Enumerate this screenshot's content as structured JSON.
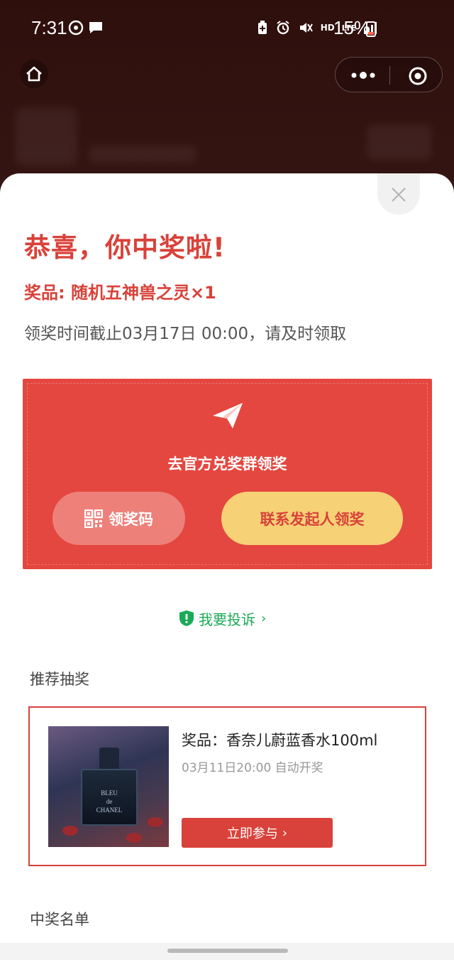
{
  "status_bar": {
    "time": "7:31",
    "network": "LTE",
    "hd": "HD",
    "battery": "15%"
  },
  "modal": {
    "title": "恭喜，你中奖啦!",
    "prize": "奖品: 随机五神兽之灵×1",
    "deadline": "领奖时间截止03月17日 00:00，请及时领取",
    "group_label": "去官方兑奖群领奖",
    "code_button": "领奖码",
    "contact_button": "联系发起人领奖"
  },
  "complaint": {
    "label": "我要投诉"
  },
  "recommended": {
    "section_title": "推荐抽奖",
    "items": [
      {
        "prize": "奖品：香奈儿蔚蓝香水100ml",
        "time": "03月11日20:00 自动开奖",
        "button": "立即参与",
        "image_text": "BLEU\nde\nCHANEL"
      }
    ]
  },
  "winners": {
    "section_title": "中奖名单"
  },
  "colors": {
    "accent_red": "#d8423a",
    "yellow_button": "#f6d176",
    "green_link": "#1aaa55"
  }
}
